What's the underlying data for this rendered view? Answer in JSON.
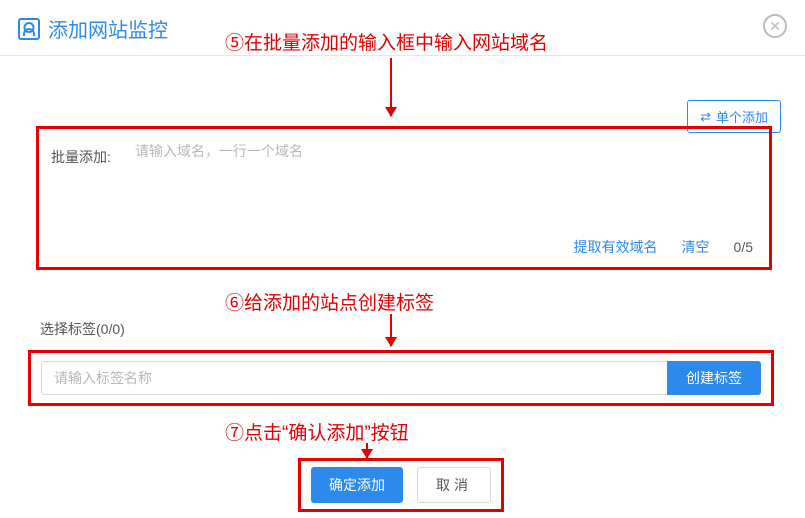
{
  "header": {
    "title": "添加网站监控",
    "close_icon": "✕"
  },
  "annotations": {
    "step5": "⑤在批量添加的输入框中输入网站域名",
    "step6": "⑥给添加的站点创建标签",
    "step7": "⑦点击“确认添加”按钮"
  },
  "toolbar": {
    "single_add_label": "单个添加",
    "swap_icon": "⇄"
  },
  "batch": {
    "label": "批量添加:",
    "placeholder": "请输入域名，一行一个域名",
    "extract_label": "提取有效域名",
    "clear_label": "清空",
    "count_display": "0/5"
  },
  "tags": {
    "section_label": "选择标签(0/0)",
    "input_placeholder": "请输入标签名称",
    "create_label": "创建标签"
  },
  "footer": {
    "confirm_label": "确定添加",
    "cancel_label": "取消"
  }
}
